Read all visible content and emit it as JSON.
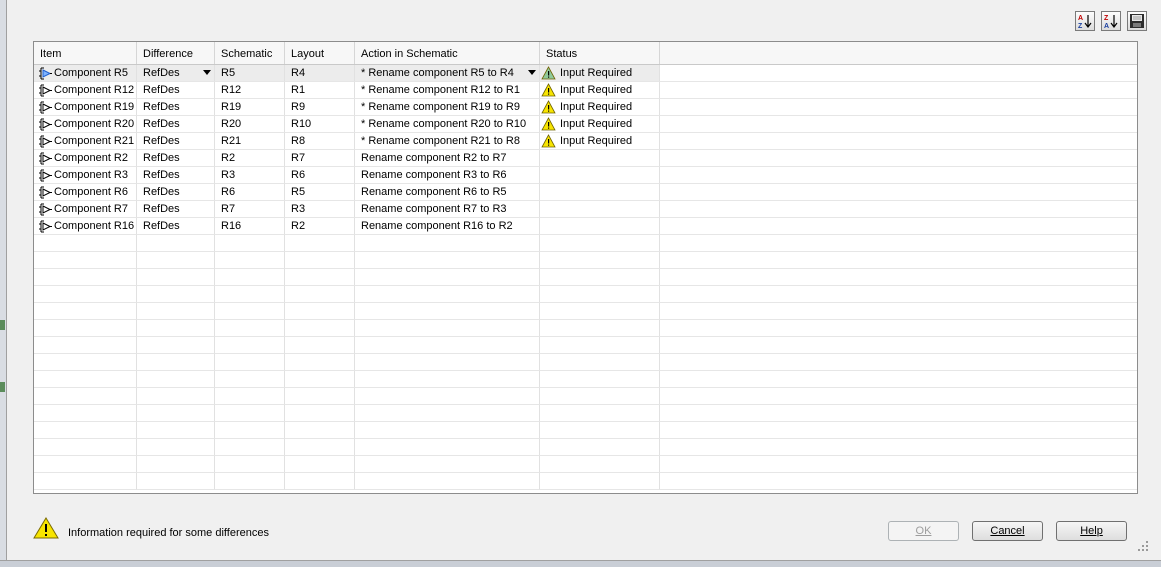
{
  "toolbar": {
    "sort_az_icon": "sort-ascending-icon",
    "sort_za_icon": "sort-descending-icon",
    "save_icon": "save-report-icon"
  },
  "table": {
    "columns": [
      "Item",
      "Difference",
      "Schematic",
      "Layout",
      "Action in Schematic",
      "Status"
    ],
    "rows": [
      {
        "item": "Component R5",
        "difference": "RefDes",
        "schematic": "R5",
        "layout": "R4",
        "action": "* Rename component R5 to R4",
        "status": "Input Required",
        "has_dropdown": true,
        "selected": true
      },
      {
        "item": "Component R12",
        "difference": "RefDes",
        "schematic": "R12",
        "layout": "R1",
        "action": "* Rename component R12 to R1",
        "status": "Input Required"
      },
      {
        "item": "Component R19",
        "difference": "RefDes",
        "schematic": "R19",
        "layout": "R9",
        "action": "* Rename component R19 to R9",
        "status": "Input Required"
      },
      {
        "item": "Component R20",
        "difference": "RefDes",
        "schematic": "R20",
        "layout": "R10",
        "action": "* Rename component R20 to R10",
        "status": "Input Required"
      },
      {
        "item": "Component R21",
        "difference": "RefDes",
        "schematic": "R21",
        "layout": "R8",
        "action": "* Rename component R21 to R8",
        "status": "Input Required"
      },
      {
        "item": "Component R2",
        "difference": "RefDes",
        "schematic": "R2",
        "layout": "R7",
        "action": "Rename component R2 to R7",
        "status": ""
      },
      {
        "item": "Component R3",
        "difference": "RefDes",
        "schematic": "R3",
        "layout": "R6",
        "action": "Rename component R3 to R6",
        "status": ""
      },
      {
        "item": "Component R6",
        "difference": "RefDes",
        "schematic": "R6",
        "layout": "R5",
        "action": "Rename component R6 to R5",
        "status": ""
      },
      {
        "item": "Component R7",
        "difference": "RefDes",
        "schematic": "R7",
        "layout": "R3",
        "action": "Rename component R7 to R3",
        "status": ""
      },
      {
        "item": "Component R16",
        "difference": "RefDes",
        "schematic": "R16",
        "layout": "R2",
        "action": "Rename component R16 to R2",
        "status": ""
      }
    ]
  },
  "footer": {
    "info_text": "Information required for some differences",
    "ok_label": "OK",
    "cancel_label": "Cancel",
    "help_label": "Help"
  },
  "colors": {
    "warning_fill": "#f7e400",
    "warning_selected_fill": "#8fc99a",
    "selected_row": "#ececec"
  }
}
